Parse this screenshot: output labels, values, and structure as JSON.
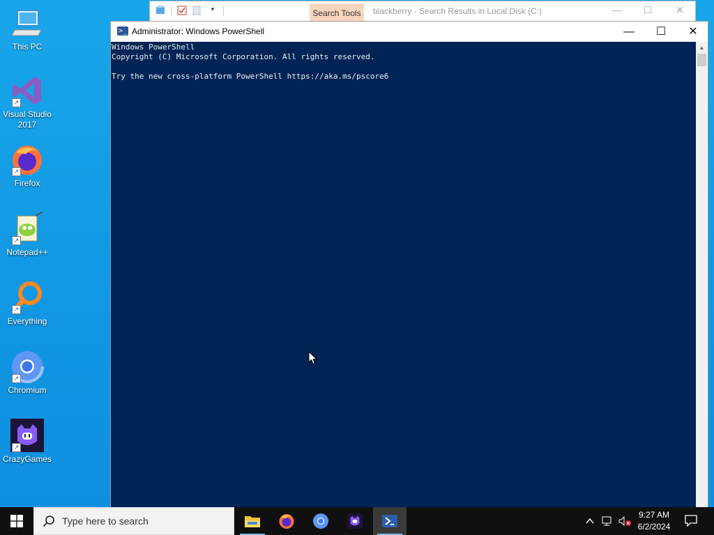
{
  "desktop": {
    "icons": [
      {
        "label": "This PC",
        "icon": "this-pc-icon"
      },
      {
        "label": "Visual Studio 2017",
        "icon": "visual-studio-icon"
      },
      {
        "label": "Firefox",
        "icon": "firefox-icon"
      },
      {
        "label": "Notepad++",
        "icon": "notepadpp-icon"
      },
      {
        "label": "Everything",
        "icon": "everything-icon"
      },
      {
        "label": "Chromium",
        "icon": "chromium-icon"
      },
      {
        "label": "CrazyGames",
        "icon": "crazygames-icon"
      }
    ]
  },
  "explorer": {
    "tab_label": "Search Tools",
    "title": "blackberry - Search Results in Local Disk (C:)"
  },
  "powershell": {
    "title": "Administrator: Windows PowerShell",
    "lines": [
      "Windows PowerShell",
      "Copyright (C) Microsoft Corporation. All rights reserved.",
      "",
      "Try the new cross-platform PowerShell https://aka.ms/pscore6"
    ],
    "colors": {
      "background": "#012456",
      "foreground": "#eeedf0"
    }
  },
  "taskbar": {
    "search_placeholder": "Type here to search",
    "apps": [
      "file-explorer-icon",
      "firefox-icon",
      "chromium-icon",
      "crazygames-icon",
      "powershell-icon"
    ],
    "active_app": "powershell-icon",
    "clock": {
      "time": "9:27 AM",
      "date": "6/2/2024"
    }
  },
  "accent": "#76b9ed"
}
